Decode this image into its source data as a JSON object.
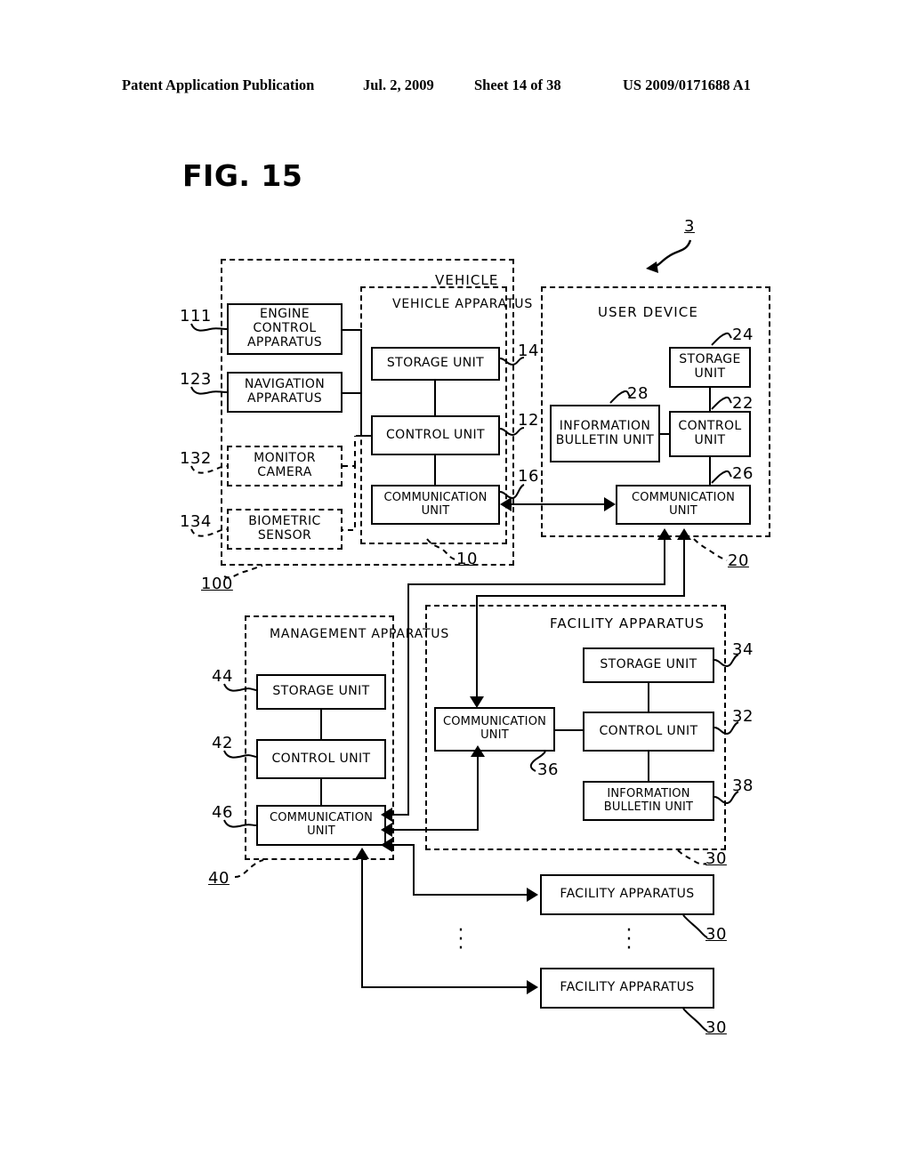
{
  "header": {
    "publication": "Patent Application Publication",
    "date": "Jul. 2, 2009",
    "sheet": "Sheet 14 of 38",
    "patent_number": "US 2009/0171688 A1"
  },
  "figure": {
    "title": "FIG. 15",
    "system_ref": "3"
  },
  "vehicle_group": {
    "label": "VEHICLE",
    "ref": "100",
    "peripherals": [
      {
        "label": "ENGINE CONTROL APPARATUS",
        "ref": "111",
        "style": "solid"
      },
      {
        "label": "NAVIGATION APPARATUS",
        "ref": "123",
        "style": "solid"
      },
      {
        "label": "MONITOR CAMERA",
        "ref": "132",
        "style": "dashed"
      },
      {
        "label": "BIOMETRIC SENSOR",
        "ref": "134",
        "style": "dashed"
      }
    ],
    "apparatus": {
      "label": "VEHICLE APPARATUS",
      "ref": "10",
      "units": [
        {
          "label": "STORAGE UNIT",
          "ref": "14"
        },
        {
          "label": "CONTROL UNIT",
          "ref": "12"
        },
        {
          "label": "COMMUNICATION UNIT",
          "ref": "16"
        }
      ]
    }
  },
  "user_device": {
    "label": "USER DEVICE",
    "ref": "20",
    "units": [
      {
        "label": "STORAGE UNIT",
        "ref": "24"
      },
      {
        "label": "CONTROL UNIT",
        "ref": "22"
      },
      {
        "label": "INFORMATION BULLETIN UNIT",
        "ref": "28"
      },
      {
        "label": "COMMUNICATION UNIT",
        "ref": "26"
      }
    ]
  },
  "management_apparatus": {
    "label": "MANAGEMENT APPARATUS",
    "ref": "40",
    "units": [
      {
        "label": "STORAGE UNIT",
        "ref": "44"
      },
      {
        "label": "CONTROL UNIT",
        "ref": "42"
      },
      {
        "label": "COMMUNICATION UNIT",
        "ref": "46"
      }
    ]
  },
  "facility_apparatus": {
    "label": "FACILITY APPARATUS",
    "ref": "30",
    "units": [
      {
        "label": "STORAGE UNIT",
        "ref": "34"
      },
      {
        "label": "CONTROL UNIT",
        "ref": "32"
      },
      {
        "label": "INFORMATION BULLETIN UNIT",
        "ref": "38"
      },
      {
        "label": "COMMUNICATION UNIT",
        "ref": "36"
      }
    ]
  },
  "additional_facilities": [
    {
      "label": "FACILITY APPARATUS",
      "ref": "30"
    },
    {
      "label": "FACILITY APPARATUS",
      "ref": "30"
    }
  ],
  "ellipsis": "⋮"
}
